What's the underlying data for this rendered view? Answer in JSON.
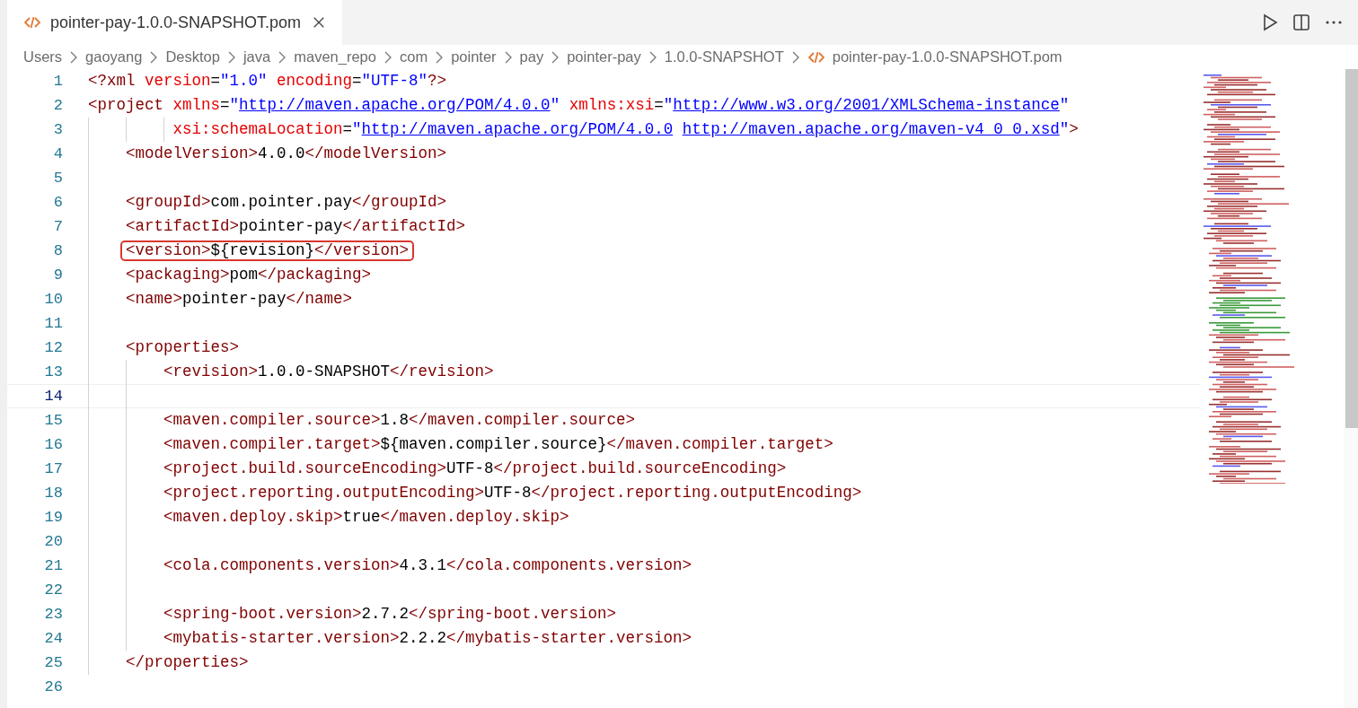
{
  "tab": {
    "title": "pointer-pay-1.0.0-SNAPSHOT.pom",
    "selected": true
  },
  "breadcrumbs": [
    {
      "label": "Users",
      "kind": "folder"
    },
    {
      "label": "gaoyang",
      "kind": "folder"
    },
    {
      "label": "Desktop",
      "kind": "folder"
    },
    {
      "label": "java",
      "kind": "folder"
    },
    {
      "label": "maven_repo",
      "kind": "folder"
    },
    {
      "label": "com",
      "kind": "folder"
    },
    {
      "label": "pointer",
      "kind": "folder"
    },
    {
      "label": "pay",
      "kind": "folder"
    },
    {
      "label": "pointer-pay",
      "kind": "folder"
    },
    {
      "label": "1.0.0-SNAPSHOT",
      "kind": "folder"
    },
    {
      "label": "pointer-pay-1.0.0-SNAPSHOT.pom",
      "kind": "file"
    }
  ],
  "lines": [
    {
      "n": "1",
      "tokens": [
        {
          "kind": "tag",
          "t": "<?xml"
        },
        {
          "kind": "attr",
          "t": " version"
        },
        {
          "kind": "text",
          "t": "="
        },
        {
          "kind": "str",
          "t": "\"1.0\""
        },
        {
          "kind": "attr",
          "t": " encoding"
        },
        {
          "kind": "text",
          "t": "="
        },
        {
          "kind": "str",
          "t": "\"UTF-8\""
        },
        {
          "kind": "tag",
          "t": "?>"
        }
      ]
    },
    {
      "n": "2",
      "tokens": [
        {
          "kind": "tag",
          "t": "<project"
        },
        {
          "kind": "attr",
          "t": " xmlns"
        },
        {
          "kind": "text",
          "t": "="
        },
        {
          "kind": "str",
          "t": "\""
        },
        {
          "kind": "link",
          "t": "http://maven.apache.org/POM/4.0.0"
        },
        {
          "kind": "str",
          "t": "\""
        },
        {
          "kind": "attr",
          "t": " xmlns:xsi"
        },
        {
          "kind": "text",
          "t": "="
        },
        {
          "kind": "str",
          "t": "\""
        },
        {
          "kind": "link",
          "t": "http://www.w3.org/2001/XMLSchema-instance"
        },
        {
          "kind": "str",
          "t": "\""
        }
      ]
    },
    {
      "n": "3",
      "tokens": [
        {
          "kind": "attr",
          "t": "         xsi:schemaLocation"
        },
        {
          "kind": "text",
          "t": "="
        },
        {
          "kind": "str",
          "t": "\""
        },
        {
          "kind": "link",
          "t": "http://maven.apache.org/POM/4.0.0 "
        },
        {
          "kind": "link",
          "t": "http://maven.apache.org/maven-v4_0_0.xsd"
        },
        {
          "kind": "str",
          "t": "\""
        },
        {
          "kind": "tag",
          "t": ">"
        }
      ]
    },
    {
      "n": "4",
      "tokens": [
        {
          "kind": "tag",
          "t": "    <modelVersion>"
        },
        {
          "kind": "text",
          "t": "4.0.0"
        },
        {
          "kind": "tag",
          "t": "</modelVersion>"
        }
      ]
    },
    {
      "n": "5"
    },
    {
      "n": "6",
      "tokens": [
        {
          "kind": "tag",
          "t": "    <groupId>"
        },
        {
          "kind": "text",
          "t": "com.pointer.pay"
        },
        {
          "kind": "tag",
          "t": "</groupId>"
        }
      ]
    },
    {
      "n": "7",
      "tokens": [
        {
          "kind": "tag",
          "t": "    <artifactId>"
        },
        {
          "kind": "text",
          "t": "pointer-pay"
        },
        {
          "kind": "tag",
          "t": "</artifactId>"
        }
      ]
    },
    {
      "n": "8",
      "annotated": true,
      "tokens": [
        {
          "kind": "tag",
          "t": "    <version>"
        },
        {
          "kind": "text",
          "t": "${revision}"
        },
        {
          "kind": "tag",
          "t": "</version>"
        }
      ]
    },
    {
      "n": "9",
      "tokens": [
        {
          "kind": "tag",
          "t": "    <packaging>"
        },
        {
          "kind": "text",
          "t": "pom"
        },
        {
          "kind": "tag",
          "t": "</packaging>"
        }
      ]
    },
    {
      "n": "10",
      "tokens": [
        {
          "kind": "tag",
          "t": "    <name>"
        },
        {
          "kind": "text",
          "t": "pointer-pay"
        },
        {
          "kind": "tag",
          "t": "</name>"
        }
      ]
    },
    {
      "n": "11"
    },
    {
      "n": "12",
      "tokens": [
        {
          "kind": "tag",
          "t": "    <properties>"
        }
      ]
    },
    {
      "n": "13",
      "tokens": [
        {
          "kind": "tag",
          "t": "        <revision>"
        },
        {
          "kind": "text",
          "t": "1.0.0-SNAPSHOT"
        },
        {
          "kind": "tag",
          "t": "</revision>"
        }
      ]
    },
    {
      "n": "14",
      "current": true
    },
    {
      "n": "15",
      "tokens": [
        {
          "kind": "tag",
          "t": "        <maven.compiler.source>"
        },
        {
          "kind": "text",
          "t": "1.8"
        },
        {
          "kind": "tag",
          "t": "</maven.compiler.source>"
        }
      ]
    },
    {
      "n": "16",
      "tokens": [
        {
          "kind": "tag",
          "t": "        <maven.compiler.target>"
        },
        {
          "kind": "text",
          "t": "${maven.compiler.source}"
        },
        {
          "kind": "tag",
          "t": "</maven.compiler.target>"
        }
      ]
    },
    {
      "n": "17",
      "tokens": [
        {
          "kind": "tag",
          "t": "        <project.build.sourceEncoding>"
        },
        {
          "kind": "text",
          "t": "UTF-8"
        },
        {
          "kind": "tag",
          "t": "</project.build.sourceEncoding>"
        }
      ]
    },
    {
      "n": "18",
      "tokens": [
        {
          "kind": "tag",
          "t": "        <project.reporting.outputEncoding>"
        },
        {
          "kind": "text",
          "t": "UTF-8"
        },
        {
          "kind": "tag",
          "t": "</project.reporting.outputEncoding>"
        }
      ]
    },
    {
      "n": "19",
      "tokens": [
        {
          "kind": "tag",
          "t": "        <maven.deploy.skip>"
        },
        {
          "kind": "text",
          "t": "true"
        },
        {
          "kind": "tag",
          "t": "</maven.deploy.skip>"
        }
      ]
    },
    {
      "n": "20"
    },
    {
      "n": "21",
      "tokens": [
        {
          "kind": "tag",
          "t": "        <cola.components.version>"
        },
        {
          "kind": "text",
          "t": "4.3.1"
        },
        {
          "kind": "tag",
          "t": "</cola.components.version>"
        }
      ]
    },
    {
      "n": "22"
    },
    {
      "n": "23",
      "tokens": [
        {
          "kind": "tag",
          "t": "        <spring-boot.version>"
        },
        {
          "kind": "text",
          "t": "2.7.2"
        },
        {
          "kind": "tag",
          "t": "</spring-boot.version>"
        }
      ]
    },
    {
      "n": "24",
      "tokens": [
        {
          "kind": "tag",
          "t": "        <mybatis-starter.version>"
        },
        {
          "kind": "text",
          "t": "2.2.2"
        },
        {
          "kind": "tag",
          "t": "</mybatis-starter.version>"
        }
      ]
    },
    {
      "n": "25",
      "tokens": [
        {
          "kind": "tag",
          "t": "    </properties>"
        }
      ]
    },
    {
      "n": "26"
    }
  ]
}
